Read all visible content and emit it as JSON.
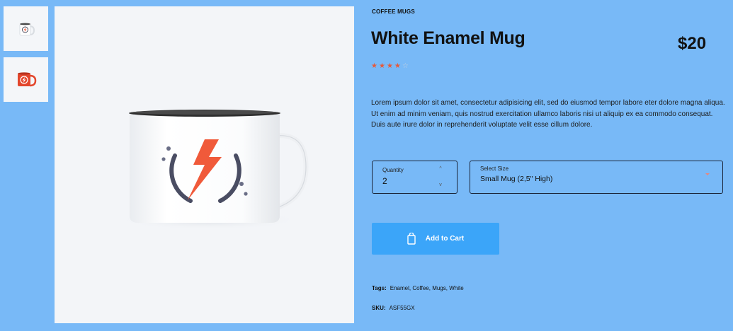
{
  "product": {
    "category": "COFFEE MUGS",
    "title": "White Enamel Mug",
    "price": "$20",
    "rating": 4,
    "rating_max": 5,
    "description": "Lorem ipsum dolor sit amet, consectetur adipisicing elit, sed do eiusmod tempor labore eter dolore magna aliqua. Ut enim ad minim veniam, quis nostrud exercitation ullamco laboris nisi ut aliquip ex ea commodo consequat. Duis aute irure dolor in reprehenderit voluptate velit esse cillum dolore."
  },
  "gallery": {
    "thumbnails": [
      {
        "icon": "white-mug-icon",
        "color": "#ffffff"
      },
      {
        "icon": "red-mug-icon",
        "color": "#e3462c"
      }
    ]
  },
  "quantity": {
    "label": "Quantity",
    "value": "2",
    "up_icon": "^",
    "down_icon": "v"
  },
  "size": {
    "label": "Select Size",
    "value": "Small Mug (2,5\" High)"
  },
  "cart": {
    "label": "Add to Cart",
    "icon": "shopping-bag-icon"
  },
  "meta": {
    "tags_label": "Tags:",
    "tags_value": "Enamel, Coffee, Mugs, White",
    "sku_label": "SKU:",
    "sku_value": "ASF55GX"
  },
  "colors": {
    "background": "#78b9f7",
    "accent": "#3ba5f9",
    "brand_orange": "#f05a3a",
    "star": "#e55a3c"
  }
}
